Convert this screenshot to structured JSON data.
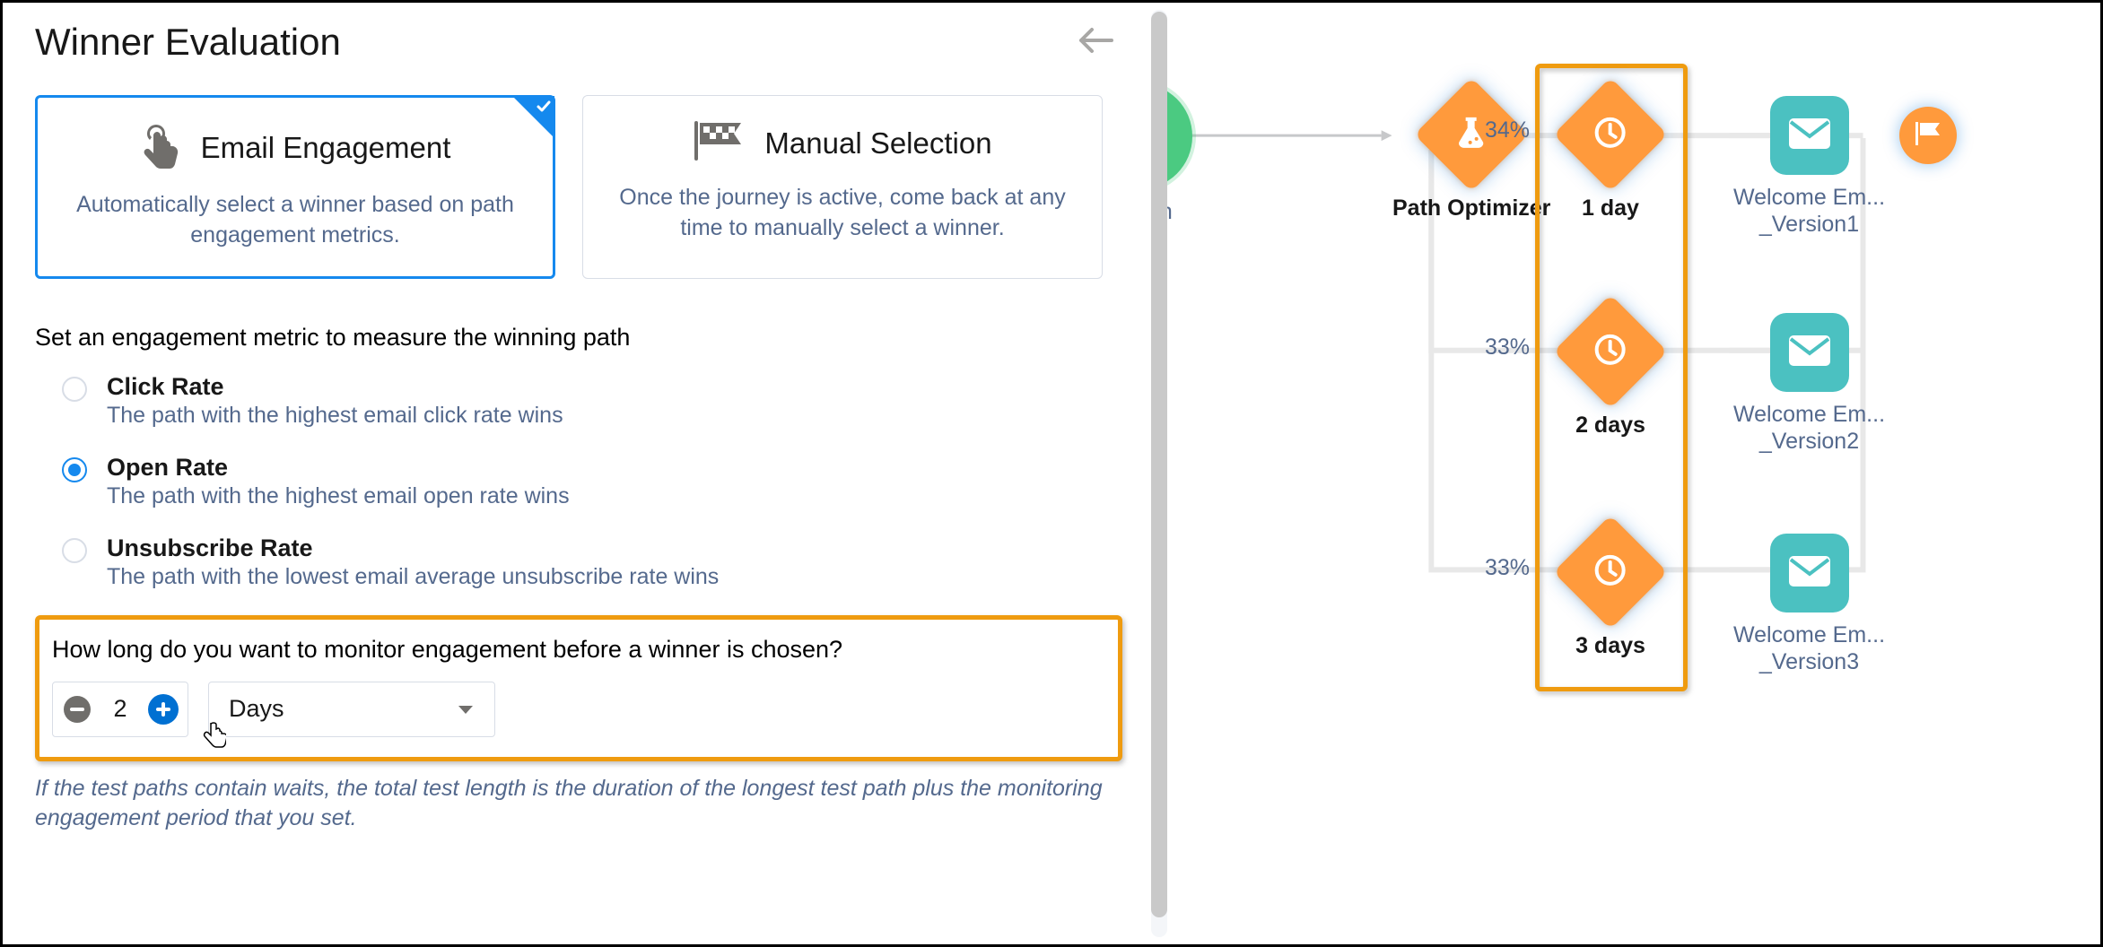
{
  "title": "Winner Evaluation",
  "cards": {
    "engagement": {
      "title": "Email Engagement",
      "desc": "Automatically select a winner based on path engagement metrics."
    },
    "manual": {
      "title": "Manual Selection",
      "desc": "Once the journey is active, come back at any time to manually select a winner."
    }
  },
  "metric_label": "Set an engagement metric to measure the winning path",
  "metrics": {
    "click": {
      "label": "Click Rate",
      "desc": "The path with the highest email click rate wins"
    },
    "open": {
      "label": "Open Rate",
      "desc": "The path with the highest email open rate wins"
    },
    "unsub": {
      "label": "Unsubscribe Rate",
      "desc": "The path with the lowest email average unsubscribe rate wins"
    }
  },
  "duration": {
    "question": "How long do you want to monitor engagement before a winner is chosen?",
    "value": "2",
    "unit": "Days"
  },
  "footnote": "If the test paths contain waits, the total test length is the duration of the longest test path plus the monitoring engagement period that you set.",
  "canvas": {
    "entry_label": "ension",
    "optimizer_label": "Path Optimizer",
    "pct": [
      "34%",
      "33%",
      "33%"
    ],
    "waits": [
      "1 day",
      "2 days",
      "3 days"
    ],
    "emails": [
      "Welcome Em...\n_Version1",
      "Welcome Em...\n_Version2",
      "Welcome Em...\n_Version3"
    ]
  }
}
